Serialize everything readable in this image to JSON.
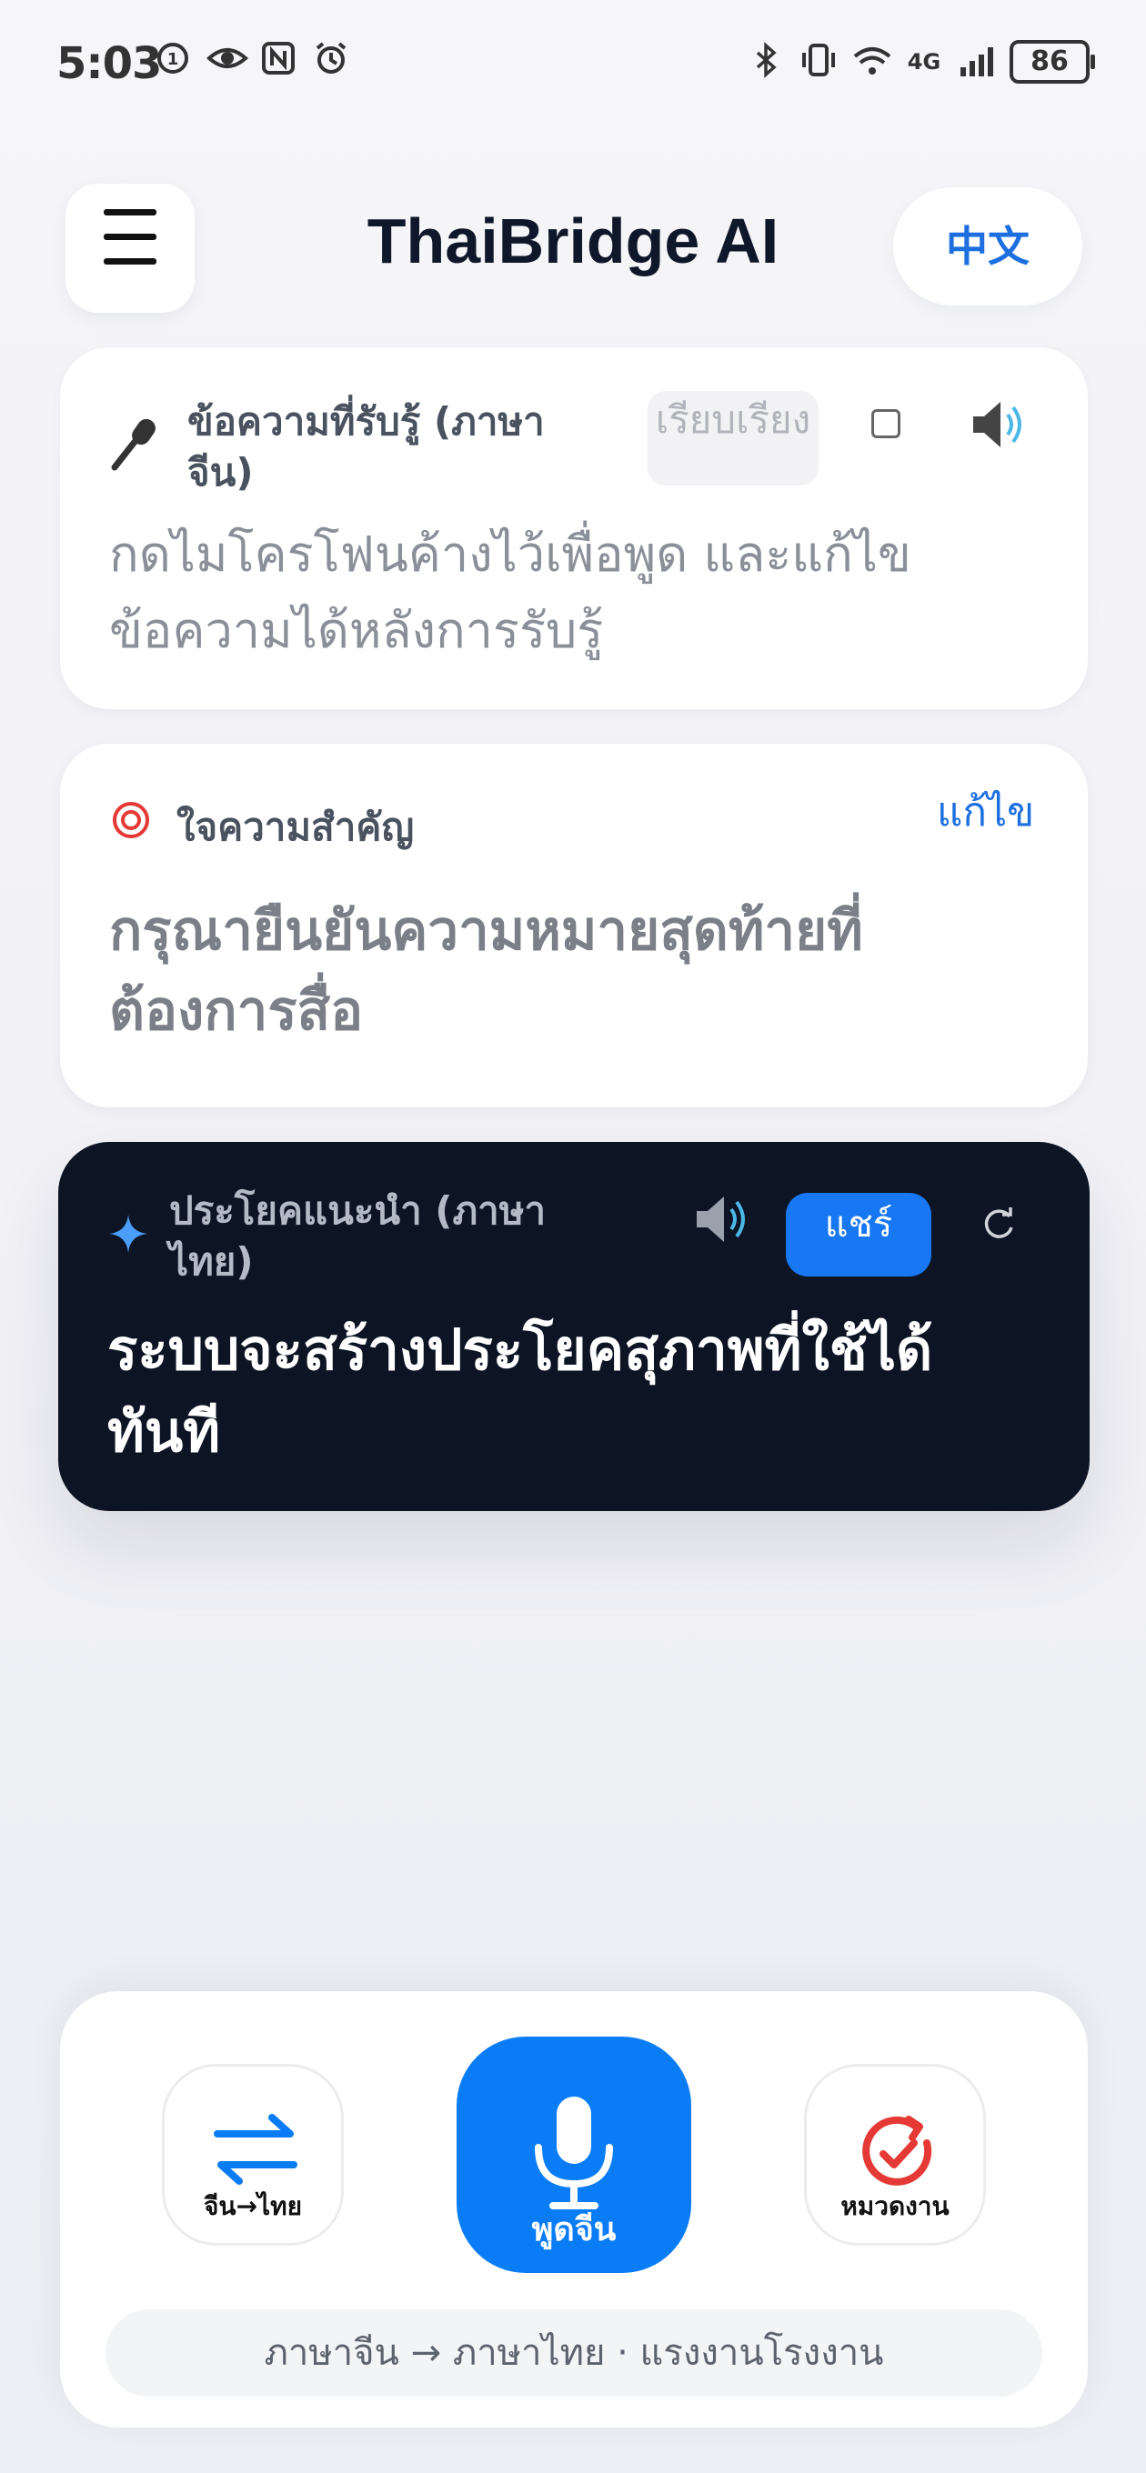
{
  "status_bar": {
    "time": "5:03",
    "battery": "86",
    "network": "4G",
    "left_icons": [
      "data-saver-icon",
      "eye-icon",
      "nfc-icon",
      "alarm-icon"
    ],
    "right_icons": [
      "bluetooth-icon",
      "vibrate-icon",
      "wifi-icon",
      "signal-4g-icon",
      "signal-icon"
    ]
  },
  "header": {
    "title": "ThaiBridge AI",
    "lang_toggle": "中文"
  },
  "recognized_card": {
    "label": "ข้อความที่รับรู้ (ภาษาจีน)",
    "rearrange": "เรียบเรียง",
    "placeholder": "กดไมโครโฟนค้างไว้เพื่อพูด และแก้ไขข้อความได้หลังการรับรู้"
  },
  "meaning_card": {
    "label": "ใจความสำคัญ",
    "edit": "แก้ไข",
    "text": "กรุณายืนยันความหมายสุดท้ายที่ต้องการสื่อ"
  },
  "suggestion_card": {
    "label": "ประโยคแนะนำ (ภาษาไทย)",
    "share": "แชร์",
    "text": "ระบบจะสร้างประโยคสุภาพที่ใช้ได้ทันที"
  },
  "controls": {
    "swap_label": "จีน→ไทย",
    "speak_label": "พูดจีน",
    "category_label": "หมวดงาน",
    "footer": "ภาษาจีน → ภาษาไทย · แรงงานโรงงาน"
  },
  "colors": {
    "accent": "#0a7cf5",
    "link": "#1d6fe0",
    "dark_card": "#0d1424",
    "category_red": "#e53935"
  }
}
